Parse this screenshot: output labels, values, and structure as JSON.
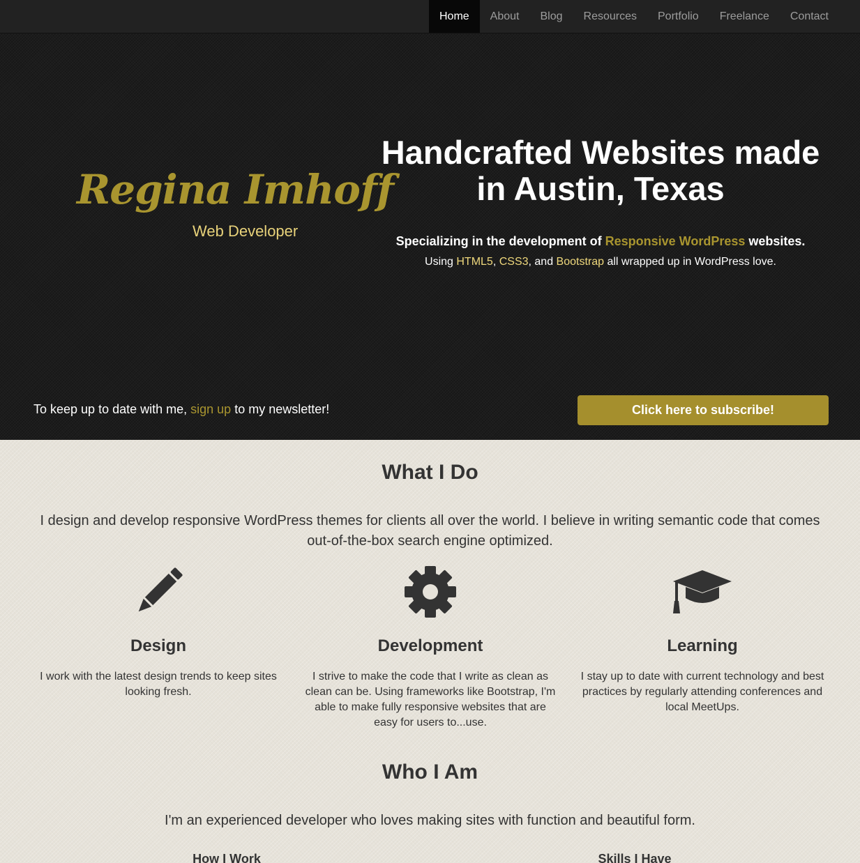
{
  "nav": {
    "items": [
      {
        "label": "Home",
        "active": true
      },
      {
        "label": "About",
        "active": false
      },
      {
        "label": "Blog",
        "active": false
      },
      {
        "label": "Resources",
        "active": false
      },
      {
        "label": "Portfolio",
        "active": false
      },
      {
        "label": "Freelance",
        "active": false
      },
      {
        "label": "Contact",
        "active": false
      }
    ]
  },
  "hero": {
    "logo_name": "Regina Imhoff",
    "logo_subtitle": "Web Developer",
    "title": "Handcrafted Websites made in Austin, Texas",
    "spec_prefix": "Specializing in the development of ",
    "spec_link": "Responsive WordPress",
    "spec_suffix": " websites.",
    "using_prefix": "Using ",
    "using_link1": "HTML5",
    "using_sep1": ", ",
    "using_link2": "CSS3",
    "using_sep2": ", and ",
    "using_link3": "Bootstrap",
    "using_suffix": " all wrapped up in WordPress love.",
    "newsletter_prefix": "To keep up to date with me, ",
    "newsletter_link": "sign up",
    "newsletter_suffix": " to my newsletter!",
    "subscribe_label": "Click here to subscribe!"
  },
  "what_i_do": {
    "title": "What I Do",
    "lead": "I design and develop responsive WordPress themes for clients all over the world. I believe in writing semantic code that comes out-of-the-box search engine optimized.",
    "columns": [
      {
        "icon": "pencil-icon",
        "title": "Design",
        "text": "I work with the latest design trends to keep sites looking fresh."
      },
      {
        "icon": "gear-icon",
        "title": "Development",
        "text": "I strive to make the code that I write as clean as clean can be. Using frameworks like Bootstrap, I'm able to make fully responsive websites that are easy for users to...use."
      },
      {
        "icon": "graduation-cap-icon",
        "title": "Learning",
        "text": "I stay up to date with current technology and best practices by regularly attending conferences and local MeetUps."
      }
    ]
  },
  "who_i_am": {
    "title": "Who I Am",
    "lead": "I'm an experienced developer who loves making sites with function and beautiful form.",
    "how_i_work": "How I Work",
    "skills_i_have": "Skills I Have"
  },
  "colors": {
    "gold": "#a9952f",
    "light_gold": "#efd87c",
    "button": "#a58f2d",
    "navbar": "#222222",
    "content_bg": "#e6e2d9"
  }
}
